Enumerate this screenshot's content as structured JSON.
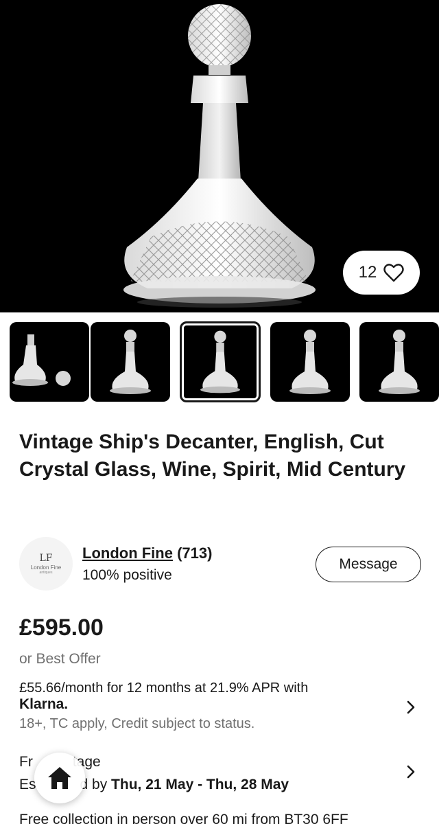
{
  "gallery": {
    "watch_count": "12",
    "thumbnails": [
      {
        "alt": "decanter-with-stopper-aside",
        "selected": false
      },
      {
        "alt": "decanter-front",
        "selected": false
      },
      {
        "alt": "decanter-front-selected",
        "selected": true
      },
      {
        "alt": "decanter-side",
        "selected": false
      },
      {
        "alt": "decanter-angle",
        "selected": false
      }
    ]
  },
  "listing": {
    "title": "Vintage Ship's Decanter, English, Cut Crystal Glass, Wine, Spirit, Mid Century"
  },
  "seller": {
    "logo_monogram": "LF",
    "logo_name": "London Fine",
    "logo_sub": "antiques",
    "name": "London Fine",
    "feedback_count": "(713)",
    "positive": "100% positive",
    "message_button": "Message"
  },
  "price": {
    "amount": "£595.00",
    "best_offer": "or Best Offer",
    "klarna_line": "£55.66/month for 12 months at 21.9% APR with",
    "klarna_brand": "Klarna.",
    "klarna_terms": "18+, TC apply, Credit subject to status."
  },
  "postage": {
    "label": "Free postage",
    "label_visible_start": "Fr",
    "label_visible_end": "tage",
    "estimate_visible_start": "Es",
    "estimate_visible_mid": "d by ",
    "estimate_dates": "Thu, 21 May - Thu, 28 May",
    "collection": "Free collection in person over 60 mi from BT30 6FF"
  },
  "icons": {
    "heart": "heart-icon",
    "chevron": "chevron-right-icon",
    "home": "home-icon"
  },
  "colors": {
    "text": "#191919",
    "muted": "#707070",
    "hero_bg": "#000000"
  }
}
